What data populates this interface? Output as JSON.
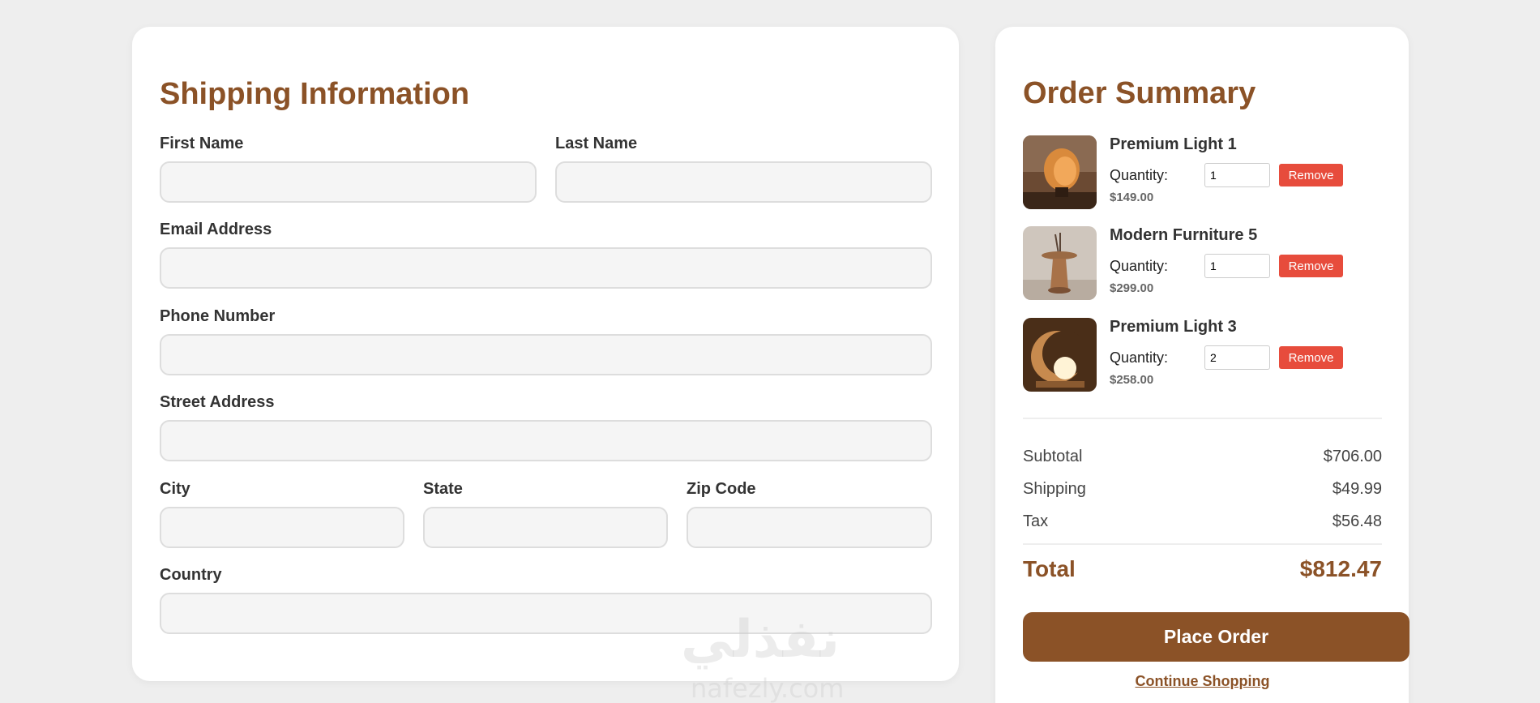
{
  "shipping": {
    "title": "Shipping Information",
    "fields": {
      "first_name": {
        "label": "First Name",
        "value": ""
      },
      "last_name": {
        "label": "Last Name",
        "value": ""
      },
      "email": {
        "label": "Email Address",
        "value": ""
      },
      "phone": {
        "label": "Phone Number",
        "value": ""
      },
      "street": {
        "label": "Street Address",
        "value": ""
      },
      "city": {
        "label": "City",
        "value": ""
      },
      "state": {
        "label": "State",
        "value": ""
      },
      "zip": {
        "label": "Zip Code",
        "value": ""
      },
      "country": {
        "label": "Country",
        "value": ""
      }
    }
  },
  "summary": {
    "title": "Order Summary",
    "quantity_label": "Quantity:",
    "remove_label": "Remove",
    "items": [
      {
        "name": "Premium Light 1",
        "quantity": "1",
        "price": "$149.00",
        "image": "lamp-image"
      },
      {
        "name": "Modern Furniture 5",
        "quantity": "1",
        "price": "$299.00",
        "image": "side-table-image"
      },
      {
        "name": "Premium Light 3",
        "quantity": "2",
        "price": "$258.00",
        "image": "moon-lamp-image"
      }
    ],
    "subtotal_label": "Subtotal",
    "subtotal_value": "$706.00",
    "shipping_label": "Shipping",
    "shipping_value": "$49.99",
    "tax_label": "Tax",
    "tax_value": "$56.48",
    "total_label": "Total",
    "total_value": "$812.47",
    "place_order_label": "Place Order",
    "continue_label": "Continue Shopping"
  },
  "watermark": {
    "text": "نفذلي",
    "subtext": "nafezly.com"
  },
  "colors": {
    "brand": "#8b5227",
    "danger": "#e74c3c",
    "background": "#eeeeee"
  }
}
